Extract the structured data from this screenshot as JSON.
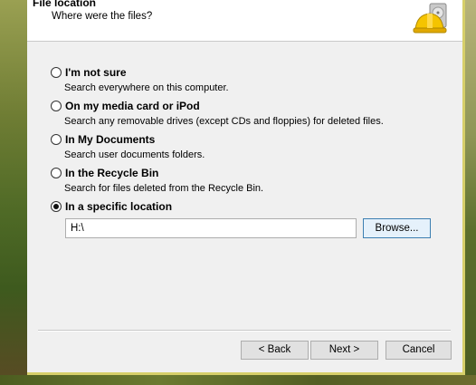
{
  "header": {
    "title": "File location",
    "subtitle": "Where were the files?"
  },
  "options": [
    {
      "label": "I'm not sure",
      "description": "Search everywhere on this computer.",
      "selected": false
    },
    {
      "label": "On my media card or iPod",
      "description": "Search any removable drives (except CDs and floppies) for deleted files.",
      "selected": false
    },
    {
      "label": "In My Documents",
      "description": "Search user documents folders.",
      "selected": false
    },
    {
      "label": "In the Recycle Bin",
      "description": "Search for files deleted from the Recycle Bin.",
      "selected": false
    },
    {
      "label": "In a specific location",
      "description": "",
      "selected": true
    }
  ],
  "location": {
    "value": "H:\\",
    "browse_label": "Browse..."
  },
  "footer": {
    "back_label": "< Back",
    "next_label": "Next >",
    "cancel_label": "Cancel"
  }
}
